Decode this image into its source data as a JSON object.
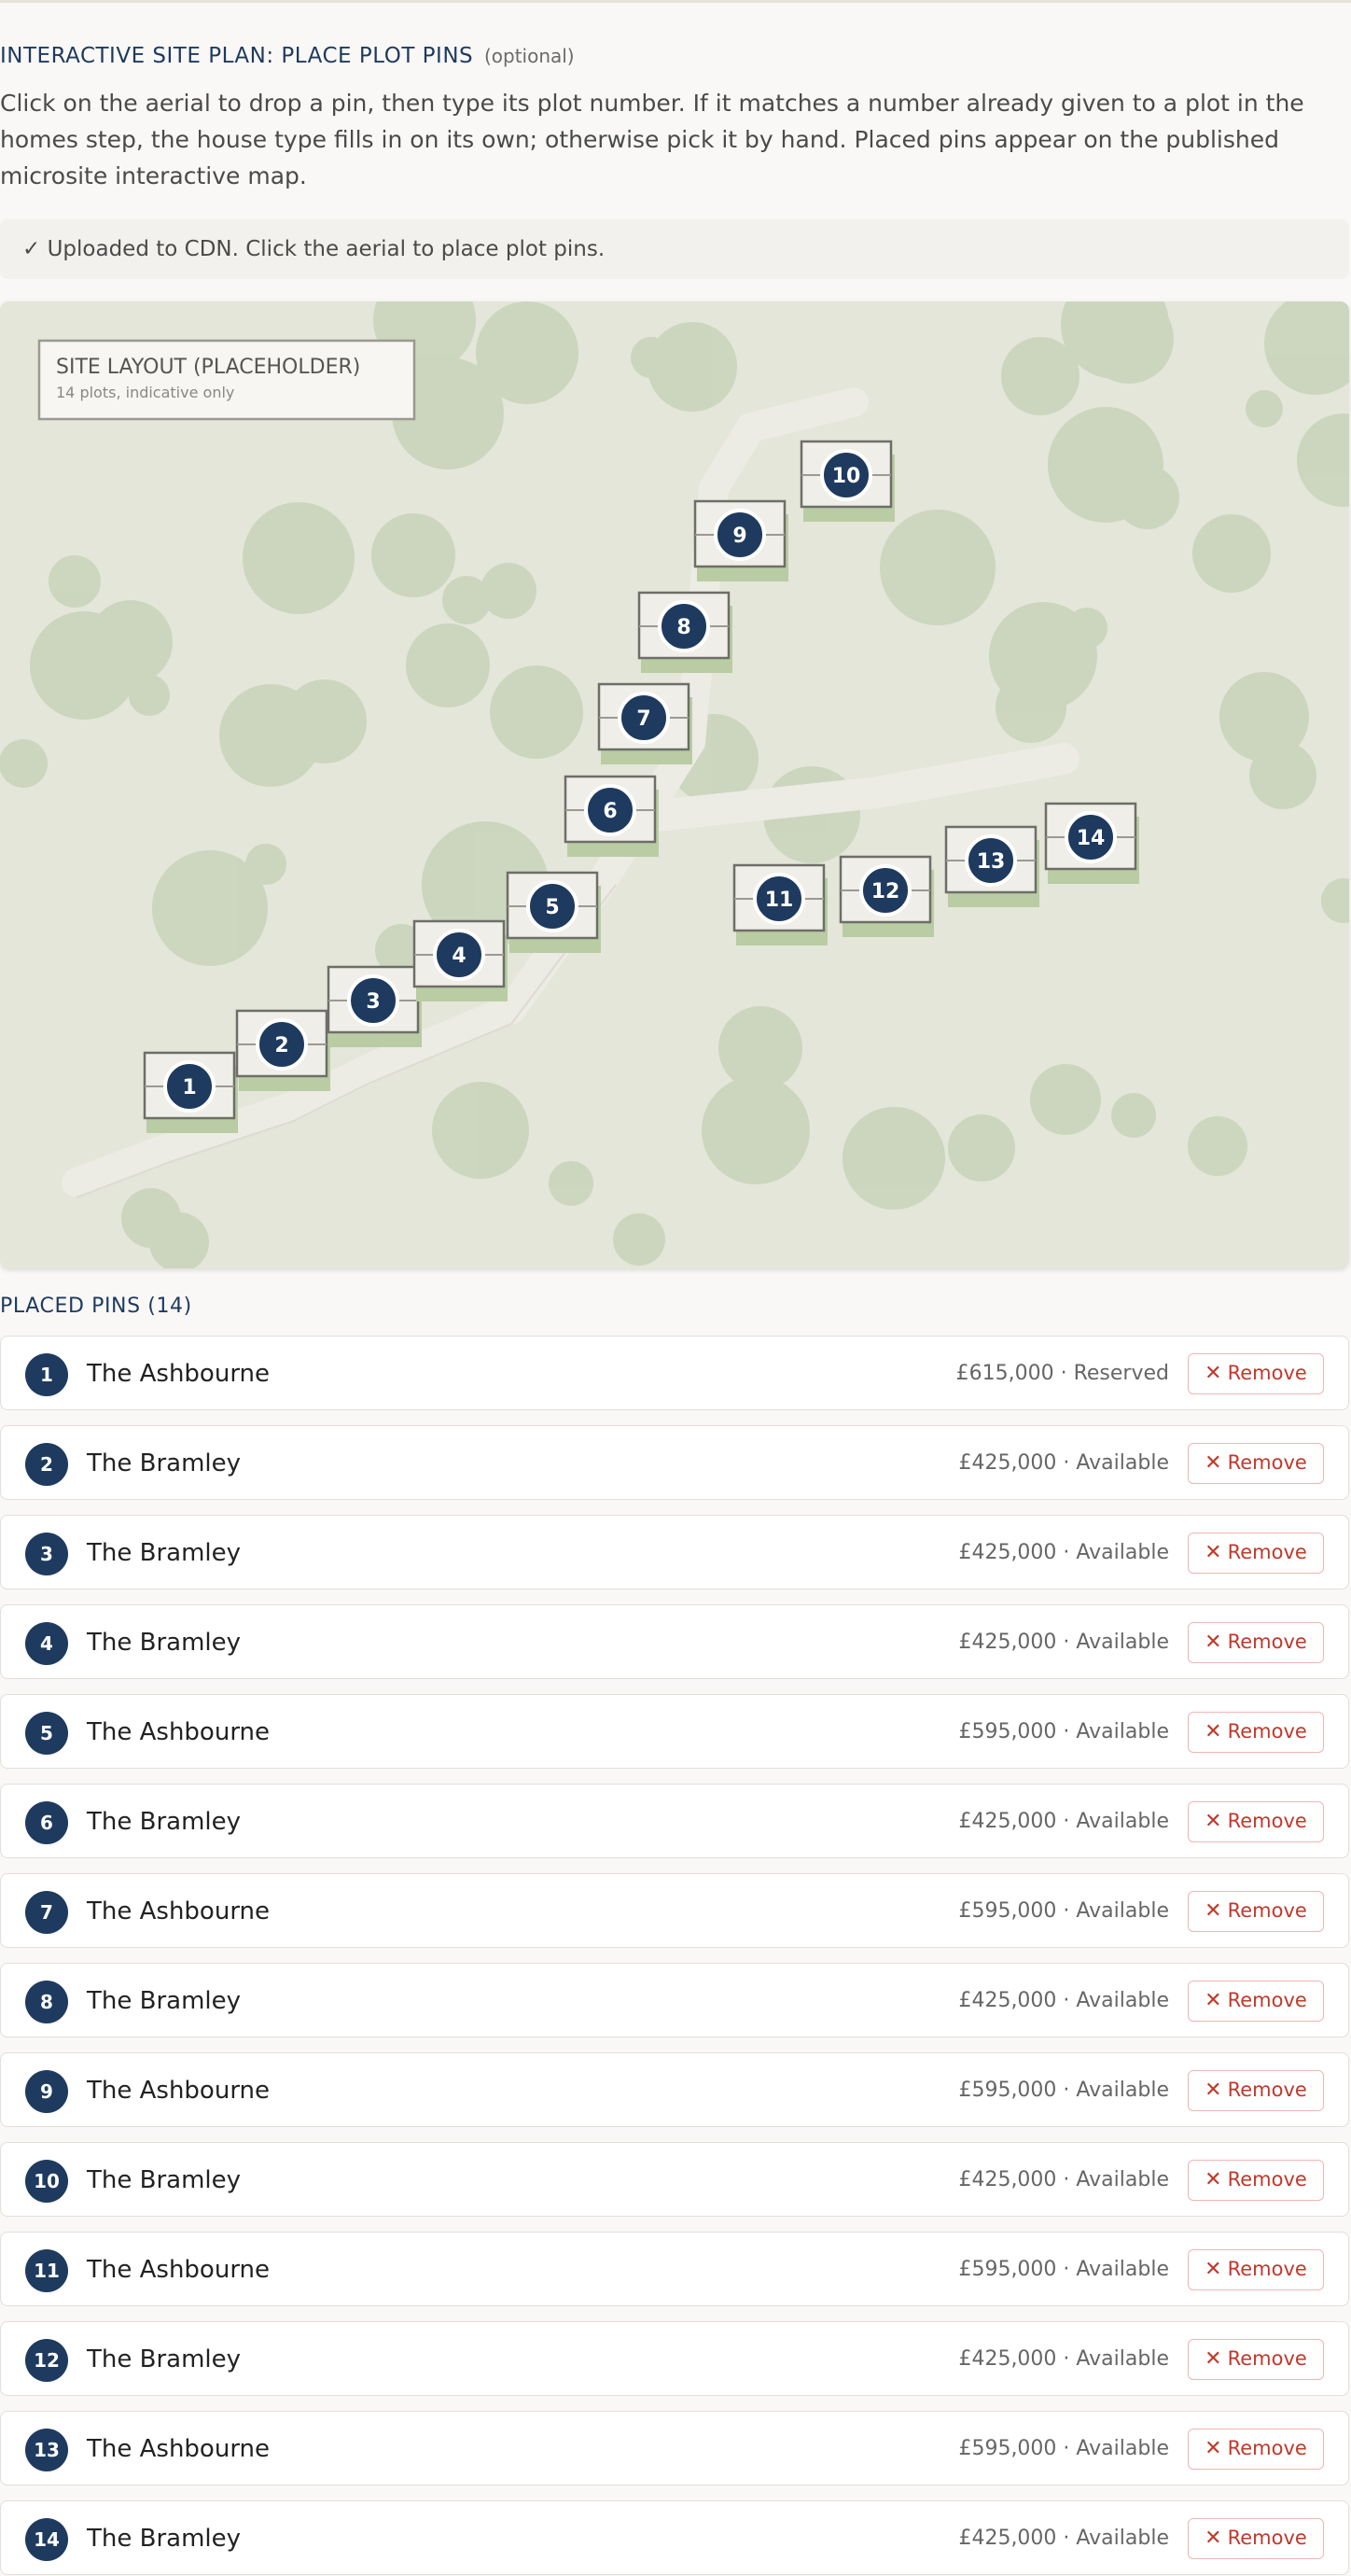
{
  "section": {
    "title": "INTERACTIVE SITE PLAN: PLACE PLOT PINS",
    "optional_label": "(optional)",
    "description": "Click on the aerial to drop a pin, then type its plot number. If it matches a number already given to a plot in the homes step, the house type fills in on its own; otherwise pick it by hand. Placed pins appear on the published microsite interactive map."
  },
  "status_message": "✓ Uploaded to CDN. Click the aerial to place plot pins.",
  "map": {
    "legend_title": "SITE LAYOUT (PLACEHOLDER)",
    "legend_subtitle": "14 plots, indicative only",
    "pin_numbers": [
      "1",
      "2",
      "3",
      "4",
      "5",
      "6",
      "7",
      "8",
      "9",
      "10",
      "11",
      "12",
      "13",
      "14"
    ]
  },
  "pins_heading": "PLACED PINS (14)",
  "pins": [
    {
      "number": "1",
      "house_type": "The Ashbourne",
      "meta": "£615,000 · Reserved",
      "remove_label": "Remove"
    },
    {
      "number": "2",
      "house_type": "The Bramley",
      "meta": "£425,000 · Available",
      "remove_label": "Remove"
    },
    {
      "number": "3",
      "house_type": "The Bramley",
      "meta": "£425,000 · Available",
      "remove_label": "Remove"
    },
    {
      "number": "4",
      "house_type": "The Bramley",
      "meta": "£425,000 · Available",
      "remove_label": "Remove"
    },
    {
      "number": "5",
      "house_type": "The Ashbourne",
      "meta": "£595,000 · Available",
      "remove_label": "Remove"
    },
    {
      "number": "6",
      "house_type": "The Bramley",
      "meta": "£425,000 · Available",
      "remove_label": "Remove"
    },
    {
      "number": "7",
      "house_type": "The Ashbourne",
      "meta": "£595,000 · Available",
      "remove_label": "Remove"
    },
    {
      "number": "8",
      "house_type": "The Bramley",
      "meta": "£425,000 · Available",
      "remove_label": "Remove"
    },
    {
      "number": "9",
      "house_type": "The Ashbourne",
      "meta": "£595,000 · Available",
      "remove_label": "Remove"
    },
    {
      "number": "10",
      "house_type": "The Bramley",
      "meta": "£425,000 · Available",
      "remove_label": "Remove"
    },
    {
      "number": "11",
      "house_type": "The Ashbourne",
      "meta": "£595,000 · Available",
      "remove_label": "Remove"
    },
    {
      "number": "12",
      "house_type": "The Bramley",
      "meta": "£425,000 · Available",
      "remove_label": "Remove"
    },
    {
      "number": "13",
      "house_type": "The Ashbourne",
      "meta": "£595,000 · Available",
      "remove_label": "Remove"
    },
    {
      "number": "14",
      "house_type": "The Bramley",
      "meta": "£425,000 · Available",
      "remove_label": "Remove"
    }
  ],
  "icons": {
    "remove": "close-icon",
    "status": "check-icon"
  },
  "colors": {
    "accent": "#1e3a5f",
    "remove": "#c0392b",
    "map_ground": "#e3e6d9",
    "tree": "#c5d0b6"
  }
}
